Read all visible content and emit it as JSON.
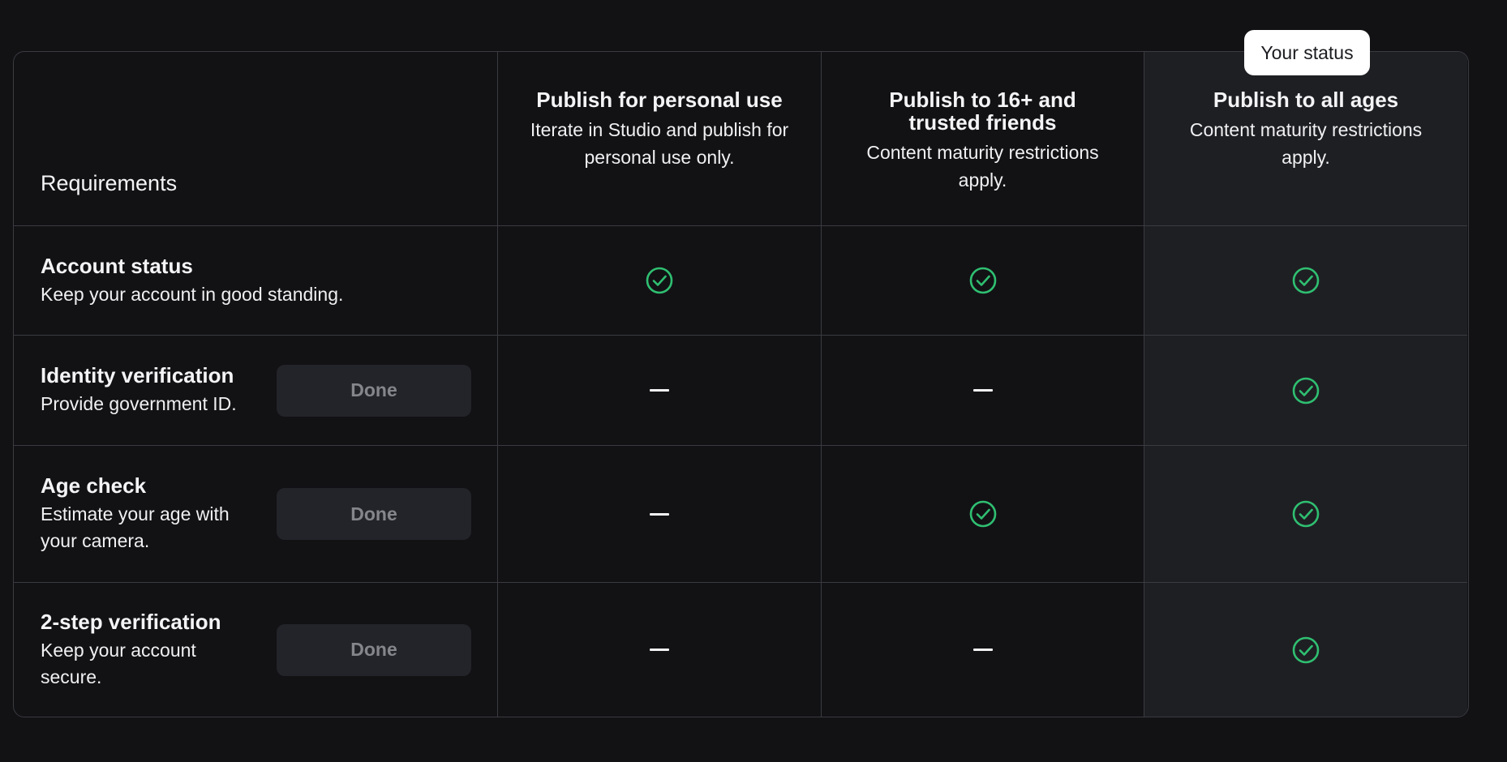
{
  "header": {
    "requirements_label": "Requirements",
    "status_badge": "Your status",
    "columns": [
      {
        "title": "Publish for personal use",
        "desc": "Iterate in Studio and publish for personal use only."
      },
      {
        "title": "Publish to 16+ and trusted friends",
        "desc": "Content maturity restrictions apply."
      },
      {
        "title": "Publish to all ages",
        "desc": "Content maturity restrictions apply."
      }
    ]
  },
  "rows": [
    {
      "title": "Account status",
      "desc": "Keep your account in good standing.",
      "button": null,
      "marks": [
        "check",
        "check",
        "check"
      ]
    },
    {
      "title": "Identity verification",
      "desc": "Provide government ID.",
      "button": "Done",
      "marks": [
        "dash",
        "dash",
        "check"
      ]
    },
    {
      "title": "Age check",
      "desc": "Estimate your age with your camera.",
      "button": "Done",
      "marks": [
        "dash",
        "check",
        "check"
      ]
    },
    {
      "title": "2-step verification",
      "desc": "Keep your account secure.",
      "button": "Done",
      "marks": [
        "dash",
        "dash",
        "check"
      ]
    }
  ],
  "colors": {
    "background": "#121215",
    "highlight_column": "#1e1f23",
    "check": "#2fbf71",
    "border": "#3a3b40"
  },
  "icons": {
    "check": "check-circle-icon",
    "dash": "dash-icon"
  }
}
